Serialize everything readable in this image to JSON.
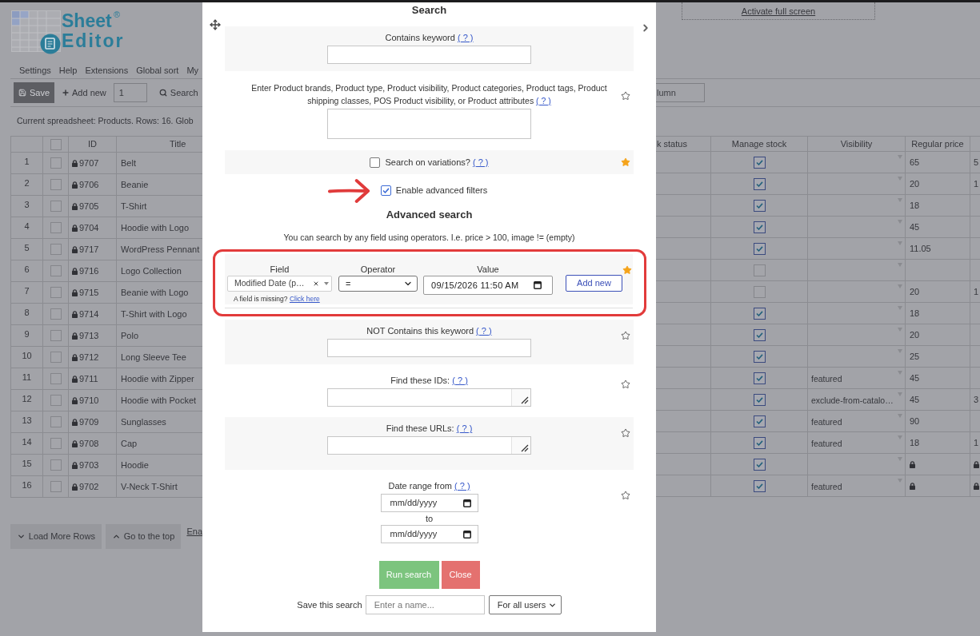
{
  "page": {
    "top_link": "Activate full screen",
    "logo": {
      "lines": [
        "Sheet",
        "Editor"
      ],
      "mark": "®"
    },
    "menu": [
      "Settings",
      "Help",
      "Extensions",
      "Global sort",
      "My"
    ],
    "toolbar": {
      "save": "Save",
      "add_new": "Add new",
      "add_count": "1",
      "search": "Search",
      "column_search_placeholder": "lumn"
    },
    "status": "Current spreadsheet: Products. Rows: 16. Glob",
    "footer": {
      "load_more": "Load More Rows",
      "go_top": "Go to the top",
      "link": "Ena"
    }
  },
  "table": {
    "select_all_checked": false,
    "left_headers": [
      "ID",
      "Title"
    ],
    "right_headers": [
      "k status",
      "Manage stock",
      "Visibility",
      "Regular price"
    ],
    "rows": [
      {
        "number": "1",
        "checked": false,
        "id": "9707",
        "title": "Belt",
        "manage_stock": true,
        "price": "65",
        "cut_column": "5",
        "locked": false
      },
      {
        "number": "2",
        "checked": false,
        "id": "9706",
        "title": "Beanie",
        "manage_stock": true,
        "price": "20",
        "cut_column": "1",
        "locked": false
      },
      {
        "number": "3",
        "checked": false,
        "id": "9705",
        "title": "T-Shirt",
        "manage_stock": true,
        "price": "18",
        "locked": false
      },
      {
        "number": "4",
        "checked": false,
        "id": "9704",
        "title": "Hoodie with Logo",
        "manage_stock": true,
        "price": "45",
        "locked": false
      },
      {
        "number": "5",
        "checked": false,
        "id": "9717",
        "title": "WordPress Pennant",
        "manage_stock": true,
        "price": "11.05",
        "locked": false
      },
      {
        "number": "6",
        "checked": false,
        "id": "9716",
        "title": "Logo Collection",
        "manage_stock": false,
        "locked": false
      },
      {
        "number": "7",
        "checked": false,
        "id": "9715",
        "title": "Beanie with Logo",
        "manage_stock": false,
        "price": "20",
        "cut_column": "1",
        "locked": false
      },
      {
        "number": "8",
        "checked": false,
        "id": "9714",
        "title": "T-Shirt with Logo",
        "manage_stock": true,
        "price": "18",
        "locked": false
      },
      {
        "number": "9",
        "checked": false,
        "id": "9713",
        "title": "Polo",
        "manage_stock": true,
        "price": "20",
        "locked": false
      },
      {
        "number": "10",
        "checked": false,
        "id": "9712",
        "title": "Long Sleeve Tee",
        "manage_stock": true,
        "price": "25",
        "locked": false
      },
      {
        "number": "11",
        "checked": false,
        "id": "9711",
        "title": "Hoodie with Zipper",
        "manage_stock": true,
        "visibility": "featured",
        "price": "45",
        "locked": false
      },
      {
        "number": "12",
        "checked": false,
        "id": "9710",
        "title": "Hoodie with Pocket",
        "manage_stock": true,
        "visibility": "exclude-from-catalo…",
        "price": "45",
        "cut_column": "3",
        "locked": false
      },
      {
        "number": "13",
        "checked": false,
        "id": "9709",
        "title": "Sunglasses",
        "manage_stock": true,
        "visibility": "featured",
        "price": "90",
        "locked": false
      },
      {
        "number": "14",
        "checked": false,
        "id": "9708",
        "title": "Cap",
        "manage_stock": true,
        "visibility": "featured",
        "price": "18",
        "cut_column": "1",
        "locked": false
      },
      {
        "number": "15",
        "checked": false,
        "id": "9703",
        "title": "Hoodie",
        "manage_stock": true,
        "locked": true
      },
      {
        "number": "16",
        "checked": false,
        "id": "9702",
        "title": "V-Neck T-Shirt",
        "manage_stock": true,
        "visibility": "featured",
        "locked": true
      }
    ]
  },
  "search_dialog": {
    "title": "Search",
    "fields": [
      {
        "kind": "text",
        "label": "Contains keyword",
        "help": "( ? )"
      },
      {
        "kind": "textarea",
        "label": "Enter Product brands, Product type, Product visibility, Product categories, Product tags, Product shipping classes, POS Product visibility, or Product attributes",
        "help": "( ? )",
        "favorite": false
      },
      {
        "kind": "checkbox",
        "label": "Search on variations?",
        "help": "( ? )",
        "checked": false,
        "favorite": true
      }
    ],
    "advanced_toggle": {
      "label": "Enable advanced filters",
      "checked": true
    },
    "advanced": {
      "heading": "Advanced search",
      "hint": "You can search by any field using operators. I.e. price > 100, image != (empty)",
      "field_label": "Field",
      "field_value": "Modified Date (p…",
      "operator_label": "Operator",
      "operator_value": "=",
      "value_label": "Value",
      "value": "09/15/2026 11:50 AM",
      "add_button": "Add new",
      "missing_text": "A field is missing?",
      "missing_link": "Click here",
      "favorite": true
    },
    "more_fields": [
      {
        "kind": "text",
        "label": "NOT Contains this keyword",
        "help": "( ? )",
        "favorite": false
      },
      {
        "kind": "resizable",
        "label": "Find these IDs:",
        "help": "( ? )",
        "favorite": false
      },
      {
        "kind": "resizable",
        "label": "Find these URLs:",
        "help": "( ? )",
        "favorite": false
      },
      {
        "kind": "date_range",
        "label": "Date range from",
        "help": "( ? )",
        "from_placeholder": "mm/dd/yyyy",
        "joiner": "to",
        "to_placeholder": "mm/dd/yyyy",
        "favorite": false
      }
    ],
    "buttons": [
      {
        "kind": "run",
        "label": "Run search"
      },
      {
        "kind": "close",
        "label": "Close"
      }
    ],
    "save": {
      "label": "Save this search",
      "placeholder": "Enter a name...",
      "audience": "For all users"
    }
  }
}
